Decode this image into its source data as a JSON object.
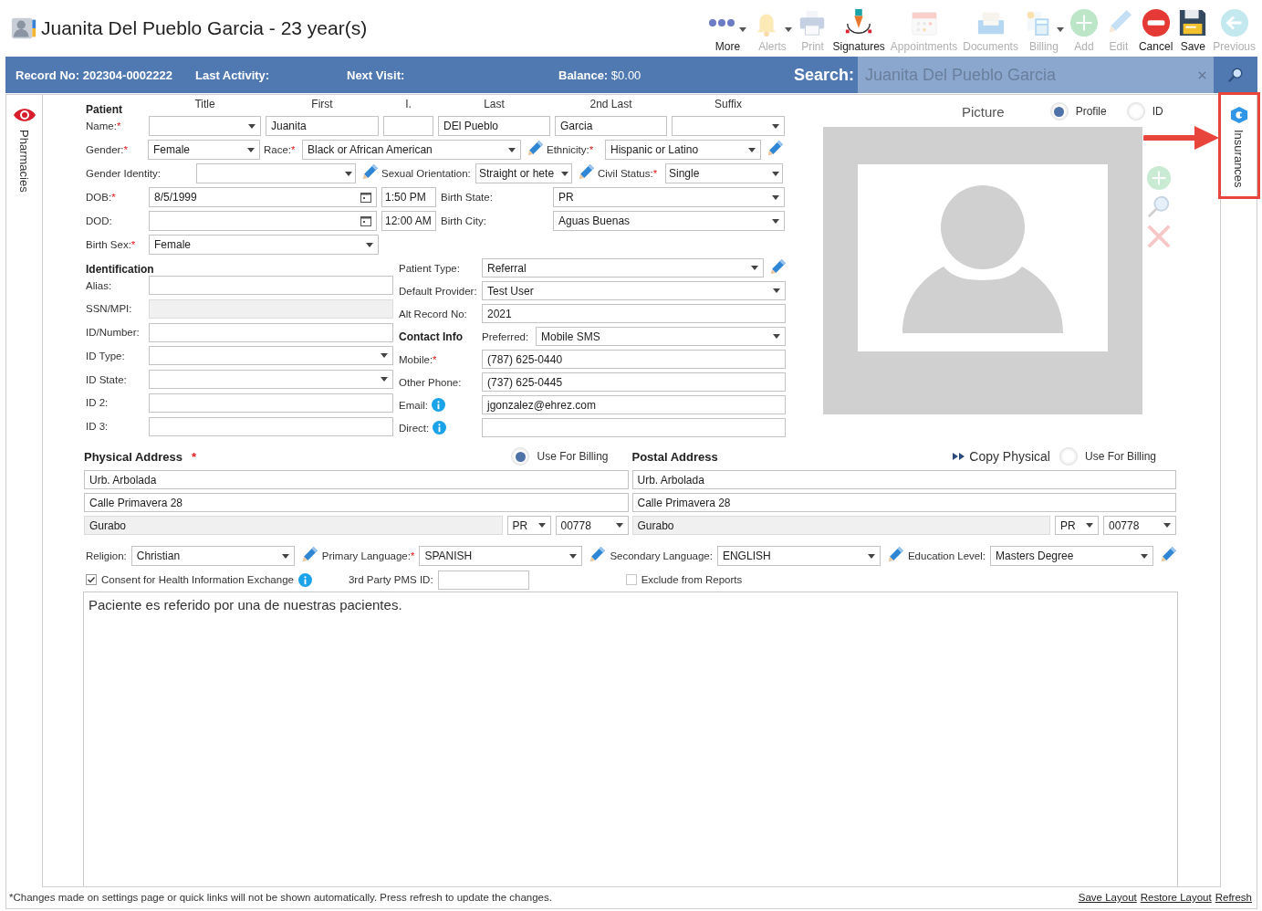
{
  "header": {
    "title": "Juanita Del Pueblo Garcia - 23 year(s)"
  },
  "toolbar": [
    {
      "kind": "more",
      "label": "More",
      "disabled": false,
      "dropdown": true
    },
    {
      "kind": "alerts",
      "label": "Alerts",
      "disabled": true,
      "dropdown": true
    },
    {
      "kind": "print",
      "label": "Print",
      "disabled": true,
      "dropdown": false
    },
    {
      "kind": "signatures",
      "label": "Signatures",
      "disabled": false,
      "dropdown": false
    },
    {
      "kind": "appointments",
      "label": "Appointments",
      "disabled": true,
      "dropdown": false
    },
    {
      "kind": "documents",
      "label": "Documents",
      "disabled": true,
      "dropdown": false
    },
    {
      "kind": "billing",
      "label": "Billing",
      "disabled": true,
      "dropdown": true
    },
    {
      "kind": "add",
      "label": "Add",
      "disabled": true,
      "dropdown": false
    },
    {
      "kind": "edit",
      "label": "Edit",
      "disabled": true,
      "dropdown": false
    },
    {
      "kind": "cancel",
      "label": "Cancel",
      "disabled": false,
      "dropdown": false
    },
    {
      "kind": "save",
      "label": "Save",
      "disabled": false,
      "dropdown": false
    },
    {
      "kind": "previous",
      "label": "Previous",
      "disabled": true,
      "dropdown": false
    }
  ],
  "info_bar": {
    "record_no": "Record No: 202304-0002222",
    "last_activity": "Last Activity:",
    "next_visit": "Next Visit:",
    "balance": "**Balance:** $0.00",
    "search_label": "Search:",
    "search_value": "Juanita Del Pueblo Garcia"
  },
  "side_tabs": {
    "left": {
      "label": "Pharmacies"
    },
    "right": {
      "label": "Insurances",
      "callout": true
    }
  },
  "patient": {
    "rows": [
      [
        {
          "kind": "heading",
          "text": "Patient"
        },
        {
          "kind": "column",
          "text": "Title"
        },
        {
          "kind": "column",
          "text": "First"
        },
        {
          "kind": "column",
          "text": "I."
        },
        {
          "kind": "column",
          "text": "Last"
        },
        {
          "kind": "column",
          "text": "2nd Last"
        },
        {
          "kind": "column",
          "text": "Suffix"
        }
      ],
      [
        {
          "kind": "label",
          "text": "Name:",
          "required_mark": "*"
        },
        {
          "kind": "select"
        },
        {
          "kind": "text",
          "value": "Juanita"
        },
        {
          "kind": "text"
        },
        {
          "kind": "text",
          "value": "DEl Pueblo"
        },
        {
          "kind": "text",
          "value": "Garcia"
        },
        {
          "kind": "select"
        }
      ],
      [
        {
          "kind": "label",
          "text": "Gender:",
          "required_mark": "*"
        },
        {
          "kind": "select",
          "value": "Female"
        },
        {
          "kind": "label",
          "text": "Race:",
          "required_mark": "*"
        },
        {
          "kind": "select",
          "value": "Black or African American"
        },
        {
          "kind": "edit"
        },
        {
          "kind": "label",
          "text": "Ethnicity:",
          "required_mark": "*"
        },
        {
          "kind": "select",
          "value": "Hispanic or Latino"
        },
        {
          "kind": "edit"
        }
      ],
      [
        {
          "kind": "label",
          "text": "Gender Identity:"
        },
        {
          "kind": "select"
        },
        {
          "kind": "edit"
        },
        {
          "kind": "label",
          "text": "Sexual Orientation:"
        },
        {
          "kind": "select",
          "value": "Straight or hete"
        },
        {
          "kind": "edit"
        },
        {
          "kind": "label",
          "text": "Civil Status:",
          "required_mark": "*"
        },
        {
          "kind": "select",
          "value": "Single"
        }
      ],
      [
        {
          "kind": "label",
          "text": "DOB:",
          "required_mark": "*"
        },
        {
          "kind": "date",
          "value": "8/5/1999"
        },
        {
          "kind": "time",
          "value": "1:50 PM"
        },
        {
          "kind": "label",
          "text": "Birth State:"
        },
        {
          "kind": "select",
          "value": "PR"
        }
      ],
      [
        {
          "kind": "label",
          "text": "DOD:"
        },
        {
          "kind": "date"
        },
        {
          "kind": "time",
          "value": "12:00 AM"
        },
        {
          "kind": "label",
          "text": "Birth City:"
        },
        {
          "kind": "select",
          "value": "Aguas Buenas"
        }
      ],
      [
        {
          "kind": "label",
          "text": "Birth Sex:",
          "required_mark": "*"
        },
        {
          "kind": "select",
          "value": "Female"
        }
      ]
    ]
  },
  "identification": {
    "heading": "Identification",
    "rows": [
      [
        {
          "kind": "label",
          "text": "Alias:"
        },
        {
          "kind": "text"
        }
      ],
      [
        {
          "kind": "label",
          "text": "SSN/MPI:"
        },
        {
          "kind": "readonly"
        }
      ],
      [
        {
          "kind": "label",
          "text": "ID/Number:"
        },
        {
          "kind": "text"
        }
      ],
      [
        {
          "kind": "label",
          "text": "ID Type:"
        },
        {
          "kind": "select"
        }
      ],
      [
        {
          "kind": "label",
          "text": "ID State:"
        },
        {
          "kind": "select"
        }
      ],
      [
        {
          "kind": "label",
          "text": "ID 2:"
        },
        {
          "kind": "text"
        }
      ],
      [
        {
          "kind": "label",
          "text": "ID 3:"
        },
        {
          "kind": "text"
        }
      ]
    ]
  },
  "contact": {
    "rows": [
      [
        {
          "kind": "label",
          "text": "Patient Type:"
        },
        {
          "kind": "select",
          "value": "Referral"
        },
        {
          "kind": "edit"
        }
      ],
      [
        {
          "kind": "label",
          "text": "Default Provider:"
        },
        {
          "kind": "select",
          "value": "Test User"
        }
      ],
      [
        {
          "kind": "label",
          "text": "Alt Record No:"
        },
        {
          "kind": "text",
          "value": "2021"
        }
      ],
      [
        {
          "kind": "heading",
          "text": "Contact Info"
        },
        {
          "kind": "label",
          "text": "Preferred:"
        },
        {
          "kind": "select",
          "value": "Mobile SMS"
        }
      ],
      [
        {
          "kind": "label",
          "text": "Mobile:",
          "required_mark": "*"
        },
        {
          "kind": "text",
          "value": "(787) 625-0440"
        }
      ],
      [
        {
          "kind": "label",
          "text": "Other Phone:"
        },
        {
          "kind": "text",
          "value": "(737) 625-0445"
        }
      ],
      [
        {
          "kind": "label",
          "text": "Email:",
          "info": true
        },
        {
          "kind": "text",
          "value": "jgonzalez@ehrez.com"
        }
      ],
      [
        {
          "kind": "label",
          "text": "Direct:",
          "info": true
        },
        {
          "kind": "text"
        }
      ]
    ]
  },
  "picture": {
    "title": "Picture",
    "modes": [
      {
        "label": "Profile",
        "selected": true
      },
      {
        "label": "ID",
        "selected": false
      }
    ]
  },
  "addresses": [
    {
      "title": "Physical Address",
      "required_mark": "*",
      "use_for_billing": {
        "label": "Use For Billing",
        "selected": true
      },
      "line1": "Urb. Arbolada",
      "line2": "Calle Primavera 28",
      "city": "Gurabo",
      "state": "PR",
      "zip": "00778"
    },
    {
      "title": "Postal Address",
      "copy_label": "Copy Physical",
      "use_for_billing": {
        "label": "Use For Billing",
        "selected": false
      },
      "line1": "Urb. Arbolada",
      "line2": "Calle Primavera 28",
      "city": "Gurabo",
      "state": "PR",
      "zip": "00778"
    }
  ],
  "details": [
    {
      "kind": "label",
      "text": "Religion:"
    },
    {
      "kind": "select",
      "value": "Christian"
    },
    {
      "kind": "edit"
    },
    {
      "kind": "label",
      "text": "Primary Language:",
      "required_mark": "*"
    },
    {
      "kind": "select",
      "value": "SPANISH"
    },
    {
      "kind": "edit"
    },
    {
      "kind": "label",
      "text": "Secondary Language:"
    },
    {
      "kind": "select",
      "value": "ENGLISH"
    },
    {
      "kind": "edit"
    },
    {
      "kind": "label",
      "text": "Education Level:"
    },
    {
      "kind": "select",
      "value": "Masters Degree"
    },
    {
      "kind": "edit"
    }
  ],
  "options": [
    {
      "kind": "checkbox",
      "label": "Consent for Health Information Exchange",
      "checked": true,
      "info": true
    },
    {
      "kind": "label",
      "text": "3rd Party PMS ID:"
    },
    {
      "kind": "text"
    },
    {
      "kind": "checkbox",
      "label": "Exclude from Reports",
      "checked": false,
      "info": false
    }
  ],
  "notes": {
    "text": "Paciente es referido por una de nuestras pacientes."
  },
  "footer": {
    "message": "*Changes made on settings page or quick links will not be shown automatically. Press refresh to update the changes.",
    "links": [
      "Save Layout",
      "Restore Layout",
      "Refresh"
    ]
  }
}
